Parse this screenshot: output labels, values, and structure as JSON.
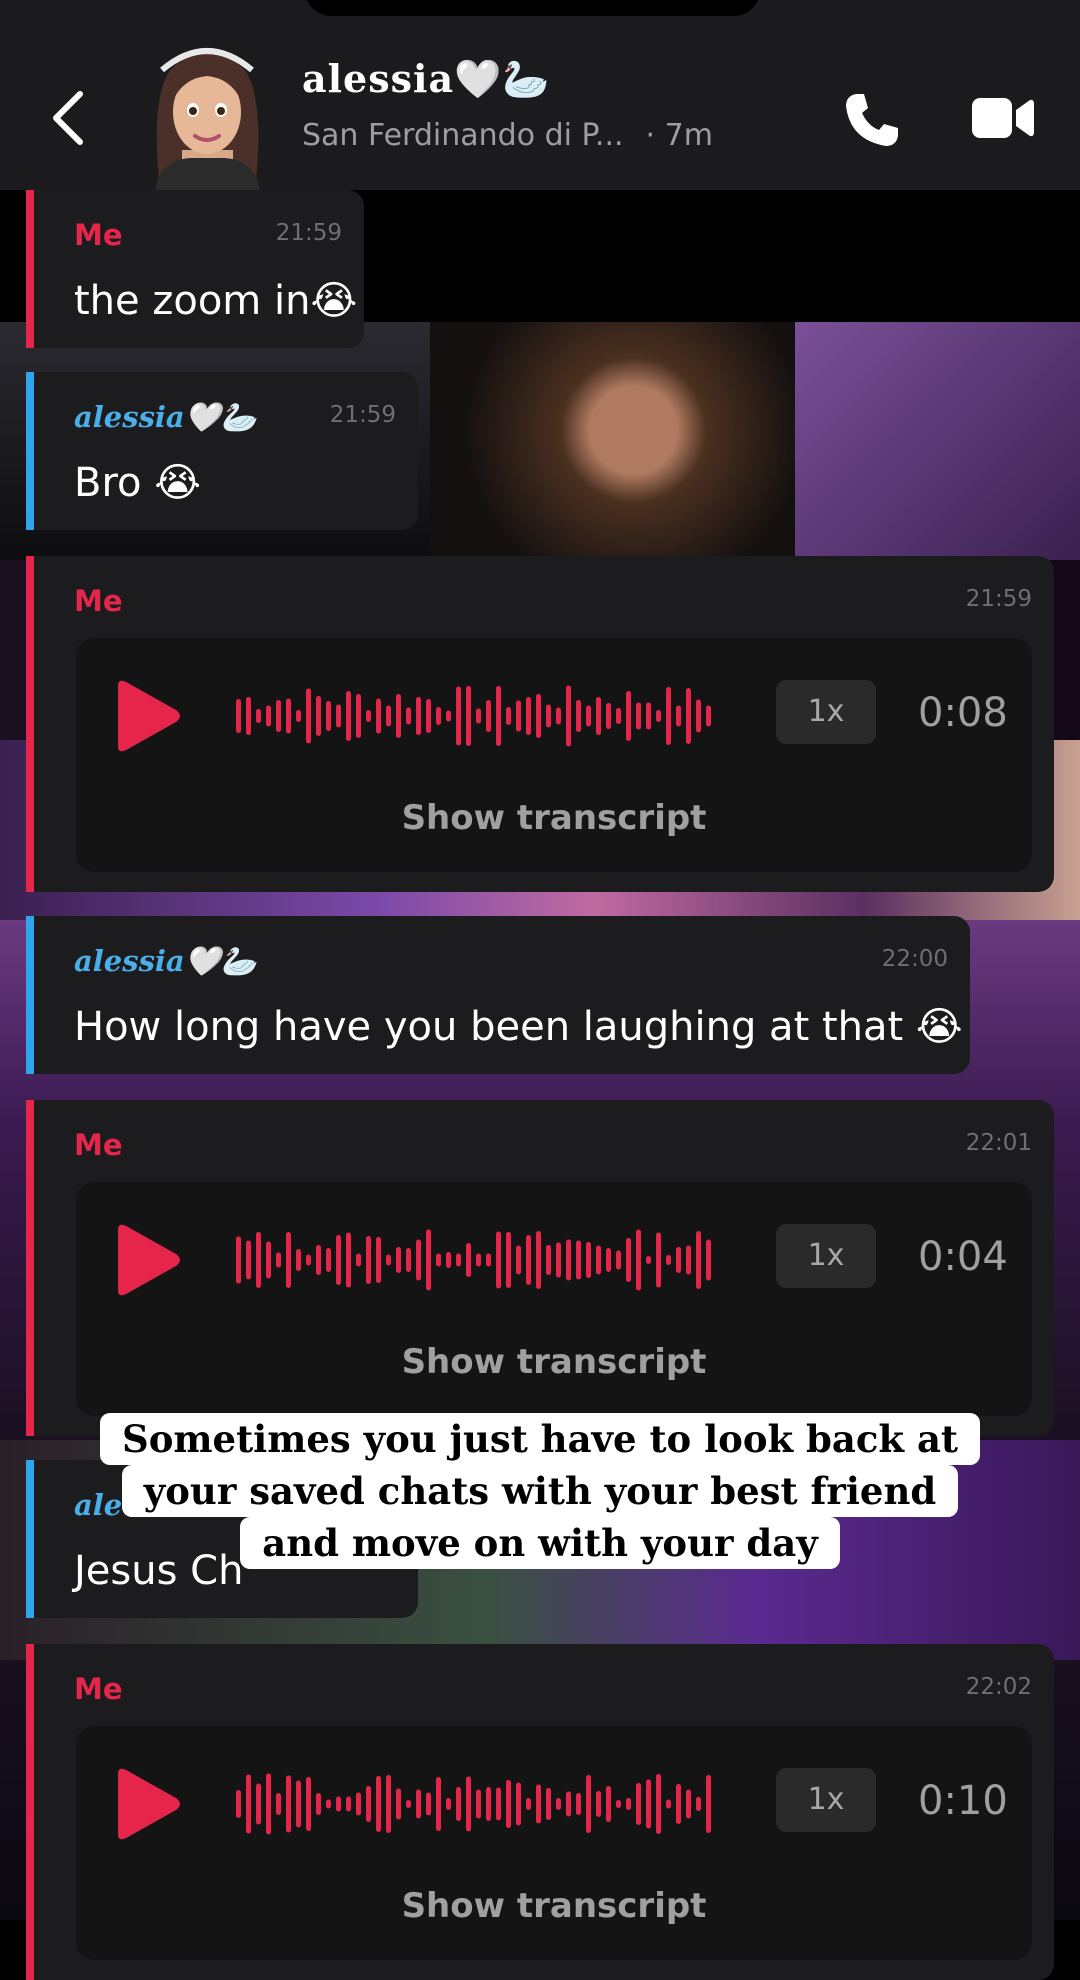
{
  "header": {
    "back_icon": "chevron-left-icon",
    "contact_name": "alessia🤍🦢",
    "location": "San Ferdinando di P...",
    "last_seen": "· 7m",
    "call_icon": "phone-icon",
    "video_icon": "video-camera-icon"
  },
  "colors": {
    "me": "#e5264a",
    "her": "#2ea6ee",
    "bubble": "#1c1c1e",
    "header": "#1b1b1d"
  },
  "messages": [
    {
      "sender": "Me",
      "time": "21:59",
      "text": "the zoom in😭"
    },
    {
      "sender": "alessia🤍🦢",
      "time": "21:59",
      "text": "Bro 😭"
    },
    {
      "sender": "Me",
      "time": "21:59",
      "voice": {
        "play_icon": "play-icon",
        "speed": "1x",
        "duration": "0:08",
        "transcript_label": "Show transcript"
      }
    },
    {
      "sender": "alessia🤍🦢",
      "time": "22:00",
      "text": "How long have you been laughing at that 😭"
    },
    {
      "sender": "Me",
      "time": "22:01",
      "voice": {
        "play_icon": "play-icon",
        "speed": "1x",
        "duration": "0:04",
        "transcript_label": "Show transcript"
      }
    },
    {
      "sender": "ale",
      "time": "",
      "text": "Jesus Ch"
    },
    {
      "sender": "Me",
      "time": "22:02",
      "voice": {
        "play_icon": "play-icon",
        "speed": "1x",
        "duration": "0:10",
        "transcript_label": "Show transcript"
      }
    }
  ],
  "caption": {
    "line1": "Sometimes you just have to look back at",
    "line2": "your saved chats with your best friend",
    "line3": "and move on with your day"
  }
}
